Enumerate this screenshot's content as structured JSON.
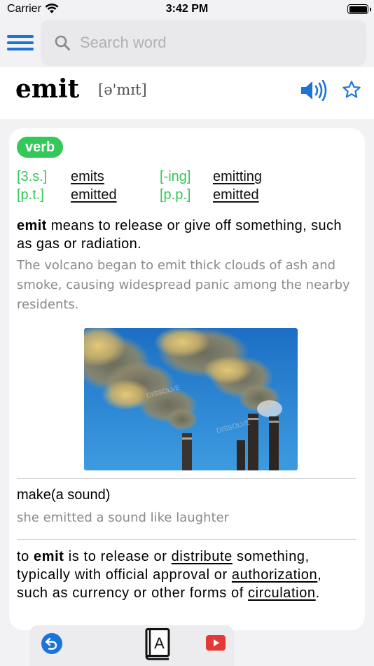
{
  "status_bar": {
    "carrier": "Carrier",
    "time": "3:42 PM"
  },
  "search": {
    "placeholder": "Search word",
    "value": ""
  },
  "entry": {
    "headword": "emit",
    "phonetic": "[ə'mɪt]"
  },
  "card": {
    "part_of_speech": "verb",
    "forms": [
      {
        "tag": "[3.s.]",
        "word": "emits"
      },
      {
        "tag": "[-ing]",
        "word": "emitting"
      },
      {
        "tag": "[p.t.]",
        "word": "emitted"
      },
      {
        "tag": "[p.p.]",
        "word": "emitted"
      }
    ],
    "sense1": {
      "bold": "emit",
      "definition": " means to release or give off something, such as gas or radiation.",
      "example": "The volcano began to emit thick clouds of ash and smoke, causing widespread panic among the nearby residents."
    },
    "image": {
      "watermark": "DISSOLVE"
    },
    "sense2": {
      "definition": "make(a sound)",
      "example": "she emitted a sound like laughter"
    },
    "sense3": {
      "p1": "to ",
      "bold": "emit",
      "p2": " is to release or ",
      "link1": "distribute",
      "p3": " something, typically with official approval or ",
      "link2": "authorization",
      "p4": ", such as currency or other forms of ",
      "link3": "circulation",
      "p5": "."
    }
  },
  "toolbar": {
    "book_letter": "A"
  },
  "colors": {
    "accent": "#1c73d8",
    "green": "#34c759",
    "red": "#e53935"
  },
  "icons": [
    "wifi-icon",
    "battery-icon",
    "menu-icon",
    "search-icon",
    "speaker-icon",
    "star-icon",
    "back-icon",
    "dictionary-book-icon",
    "video-play-icon"
  ]
}
